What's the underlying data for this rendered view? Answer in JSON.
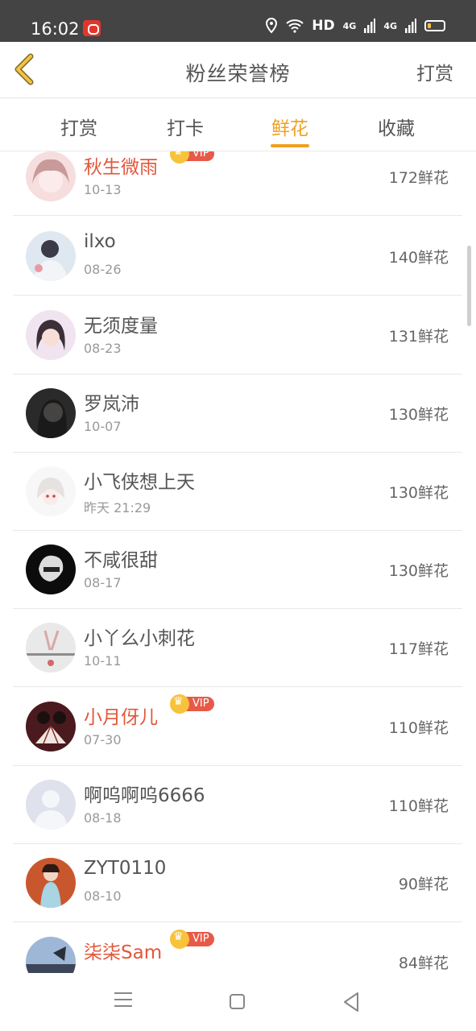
{
  "status_bar": {
    "time": "16:02",
    "network": "HD",
    "signal1": "4G",
    "signal2": "4G"
  },
  "header": {
    "title": "粉丝荣誉榜",
    "action": "打赏"
  },
  "tabs": [
    {
      "label": "打赏",
      "active": false
    },
    {
      "label": "打卡",
      "active": false
    },
    {
      "label": "鲜花",
      "active": true
    },
    {
      "label": "收藏",
      "active": false
    }
  ],
  "vip_label": "VIP",
  "accent_color": "#f0a020",
  "vip_name_color": "#e2573a",
  "fans": [
    {
      "name": "秋生微雨",
      "vip": true,
      "date": "10-13",
      "count": "172鲜花"
    },
    {
      "name": "ilxo",
      "vip": false,
      "date": "08-26",
      "count": "140鲜花"
    },
    {
      "name": "无须度量",
      "vip": false,
      "date": "08-23",
      "count": "131鲜花"
    },
    {
      "name": "罗岚沛",
      "vip": false,
      "date": "10-07",
      "count": "130鲜花"
    },
    {
      "name": "小飞侠想上天",
      "vip": false,
      "date": "昨天 21:29",
      "count": "130鲜花"
    },
    {
      "name": "不咸很甜",
      "vip": false,
      "date": "08-17",
      "count": "130鲜花"
    },
    {
      "name": "小丫么小刺花",
      "vip": false,
      "date": "10-11",
      "count": "117鲜花"
    },
    {
      "name": "小月伢儿",
      "vip": true,
      "date": "07-30",
      "count": "110鲜花"
    },
    {
      "name": "啊呜啊呜6666",
      "vip": false,
      "date": "08-18",
      "count": "110鲜花"
    },
    {
      "name": "ZYT0110",
      "vip": false,
      "date": "08-10",
      "count": "90鲜花"
    },
    {
      "name": "柒柒Sam",
      "vip": true,
      "date": "",
      "count": "84鲜花"
    }
  ]
}
